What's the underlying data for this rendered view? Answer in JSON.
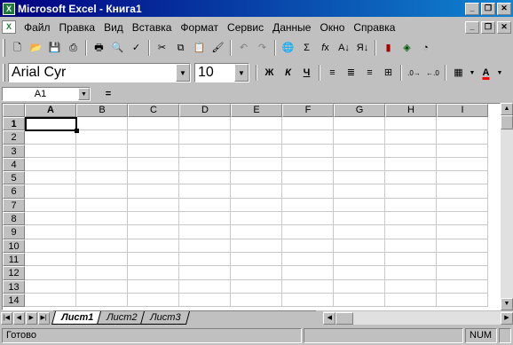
{
  "window": {
    "title": "Microsoft Excel - Книга1",
    "app_icon": "excel-logo-icon",
    "caption_buttons": [
      "minimize",
      "restore",
      "close"
    ]
  },
  "menubar": {
    "items": [
      "Файл",
      "Правка",
      "Вид",
      "Вставка",
      "Формат",
      "Сервис",
      "Данные",
      "Окно",
      "Справка"
    ]
  },
  "toolbar_standard": {
    "buttons": [
      "new-document",
      "open",
      "save",
      "print-preview-save",
      "print",
      "print-preview",
      "spell-check",
      "cut",
      "copy",
      "paste",
      "format-painter",
      "undo",
      "redo",
      "hyperlink",
      "autosum",
      "function-wizard",
      "sort-ascending",
      "sort-descending",
      "chart-wizard",
      "map",
      "drawing"
    ]
  },
  "toolbar_format": {
    "font_name": "Arial Cyr",
    "font_size": "10",
    "bold_label": "Ж",
    "italic_label": "К",
    "underline_label": "Ч"
  },
  "formula_bar": {
    "name_box": "A1",
    "equals": "=",
    "value": ""
  },
  "grid": {
    "columns": [
      "A",
      "B",
      "C",
      "D",
      "E",
      "F",
      "G",
      "H",
      "I"
    ],
    "rows": [
      "1",
      "2",
      "3",
      "4",
      "5",
      "6",
      "7",
      "8",
      "9",
      "10",
      "11",
      "12",
      "13",
      "14"
    ],
    "active_cell": "A1"
  },
  "sheets": {
    "tabs": [
      "Лист1",
      "Лист2",
      "Лист3"
    ],
    "active": "Лист1"
  },
  "statusbar": {
    "status": "Готово",
    "num": "NUM"
  }
}
